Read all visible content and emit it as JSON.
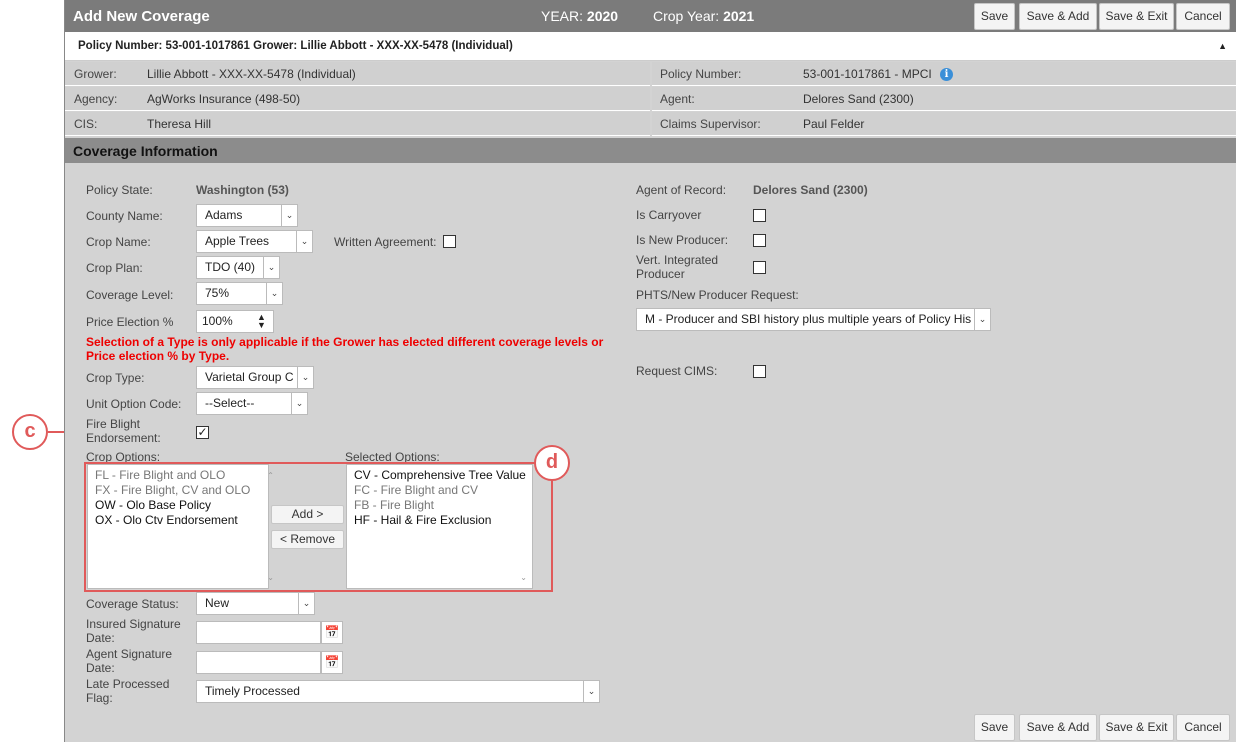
{
  "window": {
    "title": "Add New Coverage",
    "year_label": "YEAR:",
    "year": "2020",
    "crop_year_label": "Crop Year:",
    "crop_year": "2021"
  },
  "toolbar": {
    "save": "Save",
    "save_add": "Save & Add",
    "save_exit": "Save & Exit",
    "cancel": "Cancel"
  },
  "policy_bar": {
    "text": "Policy Number: 53-001-1017861 Grower: Lillie Abbott - XXX-XX-5478 (Individual)",
    "collapse": "▲"
  },
  "info": {
    "grower_label": "Grower:",
    "grower": "Lillie Abbott - XXX-XX-5478 (Individual)",
    "agency_label": "Agency:",
    "agency": "AgWorks Insurance (498-50)",
    "cis_label": "CIS:",
    "cis": "Theresa Hill",
    "policy_label": "Policy Number:",
    "policy": "53-001-1017861 - MPCI",
    "agent_label": "Agent:",
    "agent": "Delores Sand (2300)",
    "claims_label": "Claims Supervisor:",
    "claims": "Paul Felder"
  },
  "section": {
    "title": "Coverage Information"
  },
  "form": {
    "policy_state_label": "Policy State:",
    "policy_state": "Washington (53)",
    "county_label": "County Name:",
    "county": "Adams",
    "crop_label": "Crop Name:",
    "crop": "Apple Trees",
    "written_agreement_label": "Written Agreement:",
    "plan_label": "Crop Plan:",
    "plan": "TDO (40)",
    "coverage_level_label": "Coverage Level:",
    "coverage_level": "75%",
    "price_election_label": "Price Election %",
    "price_election": "100%",
    "warning": "Selection of a Type is only applicable if the Grower has elected different coverage levels or Price election % by Type.",
    "crop_type_label": "Crop Type:",
    "crop_type": "Varietal Group C",
    "unit_option_label": "Unit Option Code:",
    "unit_option": "--Select--",
    "fire_blight_label_1": "Fire Blight",
    "fire_blight_label_2": "Endorsement:",
    "fire_blight_checked": true,
    "crop_options_label": "Crop Options:",
    "selected_options_label": "Selected Options:",
    "crop_options": [
      {
        "label": "FL - Fire Blight and OLO",
        "enabled": false
      },
      {
        "label": "FX - Fire Blight, CV and OLO",
        "enabled": false
      },
      {
        "label": "OW - Olo Base Policy",
        "enabled": true
      },
      {
        "label": "OX - Olo Ctv Endorsement",
        "enabled": true
      }
    ],
    "selected_options": [
      {
        "label": "CV - Comprehensive Tree Value",
        "enabled": true
      },
      {
        "label": "FC - Fire Blight and CV",
        "enabled": false
      },
      {
        "label": "FB - Fire Blight",
        "enabled": false
      },
      {
        "label": "HF - Hail & Fire Exclusion",
        "enabled": true
      }
    ],
    "add_btn": "Add >",
    "remove_btn": "< Remove",
    "status_label": "Coverage Status:",
    "status": "New",
    "insured_sig_label_1": "Insured Signature",
    "insured_sig_label_2": "Date:",
    "agent_sig_label_1": "Agent Signature",
    "agent_sig_label_2": "Date:",
    "late_label_1": "Late Processed",
    "late_label_2": "Flag:",
    "late": "Timely Processed",
    "agent_record_label": "Agent of Record:",
    "agent_record": "Delores Sand (2300)",
    "carryover_label": "Is Carryover",
    "new_producer_label": "Is New Producer:",
    "vert_label_1": "Vert. Integrated",
    "vert_label_2": "Producer",
    "phts_label": "PHTS/New Producer Request:",
    "phts": "M - Producer and SBI history plus multiple years of Policy His",
    "cims_label": "Request CIMS:"
  },
  "callouts": {
    "c": "c",
    "d": "d"
  },
  "colors": {
    "header": "#7b7b7b",
    "section": "#8c8c8c",
    "panel": "#d3d3d3",
    "warning": "#e00000",
    "callout": "#e05a5a"
  }
}
